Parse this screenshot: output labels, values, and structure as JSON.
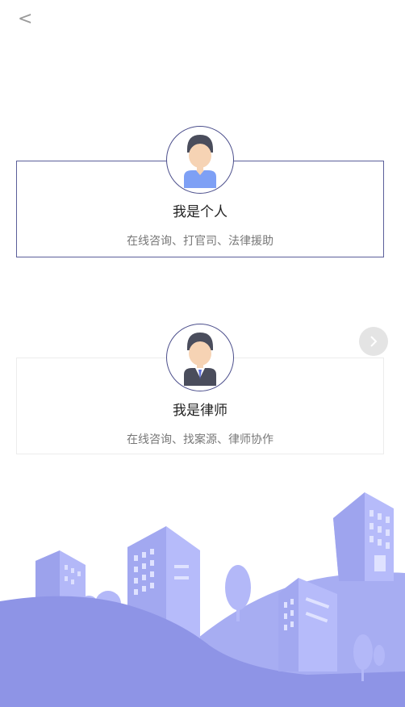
{
  "nav": {
    "back_icon": "chevron-left-icon",
    "back_glyph": "<"
  },
  "roles": [
    {
      "title": "我是个人",
      "subtitle": "在线咨询、打官司、法律援助",
      "avatar_icon": "person-avatar-icon",
      "selected": true
    },
    {
      "title": "我是律师",
      "subtitle": "在线咨询、找案源、律师协作",
      "avatar_icon": "lawyer-avatar-icon",
      "selected": false
    }
  ],
  "next_button": {
    "icon": "chevron-right-icon"
  },
  "colors": {
    "accent_border": "#5b5f9a",
    "illustration_light": "#aab0f5",
    "illustration_dark": "#8e94e6"
  }
}
